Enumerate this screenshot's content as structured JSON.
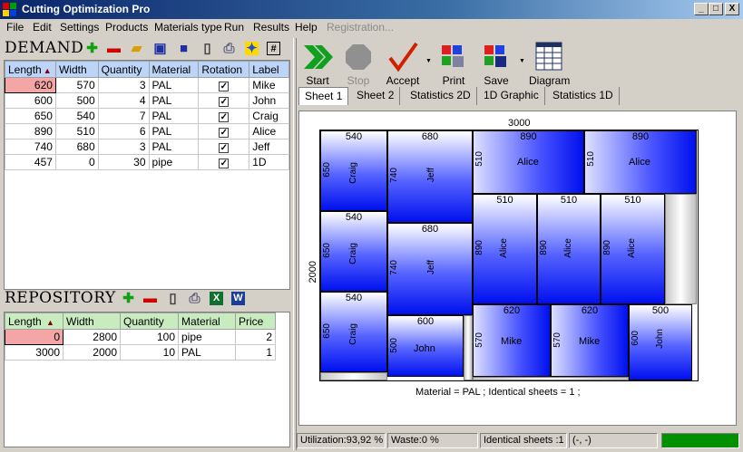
{
  "window": {
    "title": "Cutting Optimization Pro",
    "minimize": "_",
    "maximize": "□",
    "close": "X"
  },
  "menu": [
    "File",
    "Edit",
    "Settings",
    "Products",
    "Materials type",
    "Run",
    "Results",
    "Help",
    "Registration..."
  ],
  "demand": {
    "title": "DEMAND",
    "columns": [
      "Length",
      "Width",
      "Quantity",
      "Material",
      "Rotation",
      "Label"
    ],
    "rows": [
      {
        "length": "620",
        "width": "570",
        "quantity": "3",
        "material": "PAL",
        "rotation": "✓",
        "label": "Mike"
      },
      {
        "length": "600",
        "width": "500",
        "quantity": "4",
        "material": "PAL",
        "rotation": "✓",
        "label": "John"
      },
      {
        "length": "650",
        "width": "540",
        "quantity": "7",
        "material": "PAL",
        "rotation": "✓",
        "label": "Craig"
      },
      {
        "length": "890",
        "width": "510",
        "quantity": "6",
        "material": "PAL",
        "rotation": "✓",
        "label": "Alice"
      },
      {
        "length": "740",
        "width": "680",
        "quantity": "3",
        "material": "PAL",
        "rotation": "✓",
        "label": "Jeff"
      },
      {
        "length": "457",
        "width": "0",
        "quantity": "30",
        "material": "pipe",
        "rotation": "✓",
        "label": "1D"
      }
    ]
  },
  "repository": {
    "title": "REPOSITORY",
    "columns": [
      "Length",
      "Width",
      "Quantity",
      "Material",
      "Price"
    ],
    "rows": [
      {
        "length": "0",
        "width": "2800",
        "quantity": "100",
        "material": "pipe",
        "price": "2"
      },
      {
        "length": "3000",
        "width": "2000",
        "quantity": "10",
        "material": "PAL",
        "price": "1"
      }
    ]
  },
  "toolbar": {
    "start": "Start",
    "stop": "Stop",
    "accept": "Accept",
    "print": "Print",
    "save": "Save",
    "diagram": "Diagram"
  },
  "tabs": [
    "Sheet 1",
    "Sheet 2",
    "Statistics 2D",
    "1D Graphic",
    "Statistics 1D"
  ],
  "sheet": {
    "width_label": "3000",
    "height_label": "2000",
    "pieces": {
      "p1": {
        "w": "540",
        "h": "650",
        "label": "Craig"
      },
      "p2": {
        "w": "680",
        "h": "740",
        "label": "Jeff"
      },
      "p3": {
        "w": "890",
        "h": "510",
        "label": "Alice"
      },
      "p4": {
        "w": "890",
        "h": "510",
        "label": "Alice"
      },
      "p5": {
        "w": "540",
        "h": "650",
        "label": "Craig"
      },
      "p6": {
        "w": "680",
        "h": "740",
        "label": "Jeff"
      },
      "p7": {
        "w": "510",
        "h": "890",
        "label": "Alice"
      },
      "p8": {
        "w": "510",
        "h": "890",
        "label": "Alice"
      },
      "p9": {
        "w": "510",
        "h": "890",
        "label": "Alice"
      },
      "p10": {
        "w": "540",
        "h": "650",
        "label": "Craig"
      },
      "p11": {
        "w": "600",
        "h": "500",
        "label": "John"
      },
      "p12": {
        "w": "620",
        "h": "570",
        "label": "Mike"
      },
      "p13": {
        "w": "620",
        "h": "570",
        "label": "Mike"
      },
      "p14": {
        "w": "500",
        "h": "600",
        "label": "John"
      }
    },
    "caption": "Material = PAL ; Identical sheets  = 1 ;"
  },
  "status": {
    "utilization": "Utilization:93,92 %",
    "waste": "Waste:0 %",
    "identical": "Identical sheets :1",
    "coords": "(-, -)"
  },
  "colors": {
    "title_bar": "#0a246a",
    "selected_cell": "#f4a6a6",
    "piece_blue": "#0010ee",
    "status_green": "#009000"
  }
}
